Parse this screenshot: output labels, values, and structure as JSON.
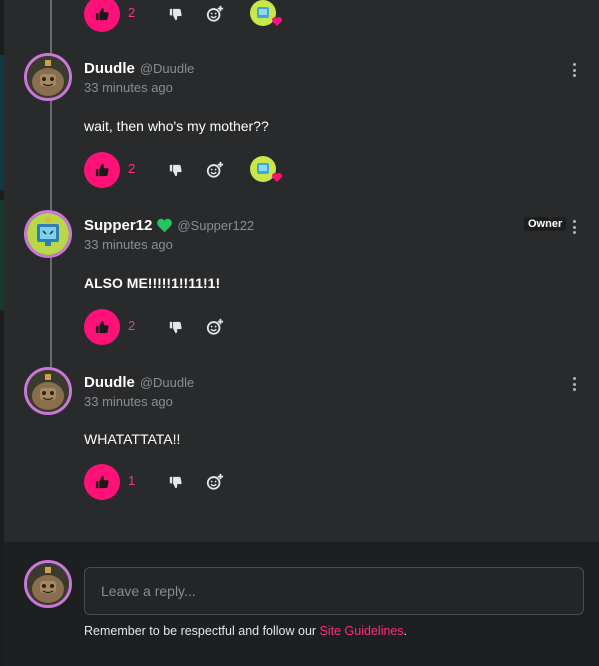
{
  "colors": {
    "accent": "#ff1177",
    "owner_heart": "#22c55e",
    "avatar_ring": "#c878d6"
  },
  "top_actions": {
    "like_count": "2"
  },
  "comments": [
    {
      "username": "Duudle",
      "handle": "@Duudle",
      "time": "33 minutes ago",
      "text": "wait, then who's my mother??",
      "like_count": "2",
      "has_reaction": true,
      "is_owner": false,
      "avatar_icon": "sloth-avatar-icon"
    },
    {
      "username": "Supper12",
      "handle": "@Supper122",
      "badge": "Owner",
      "time": "33 minutes ago",
      "text": "ALSO ME!!!!!1!!11!1!",
      "like_count": "2",
      "has_reaction": false,
      "is_owner": true,
      "avatar_icon": "monitor-avatar-icon"
    },
    {
      "username": "Duudle",
      "handle": "@Duudle",
      "time": "33 minutes ago",
      "text": "WHATATTATA!!",
      "like_count": "1",
      "has_reaction": false,
      "is_owner": false,
      "avatar_icon": "sloth-avatar-icon"
    }
  ],
  "reply": {
    "placeholder": "Leave a reply...",
    "notice_prefix": "Remember to be respectful and follow our ",
    "notice_link": "Site Guidelines",
    "notice_suffix": "."
  }
}
